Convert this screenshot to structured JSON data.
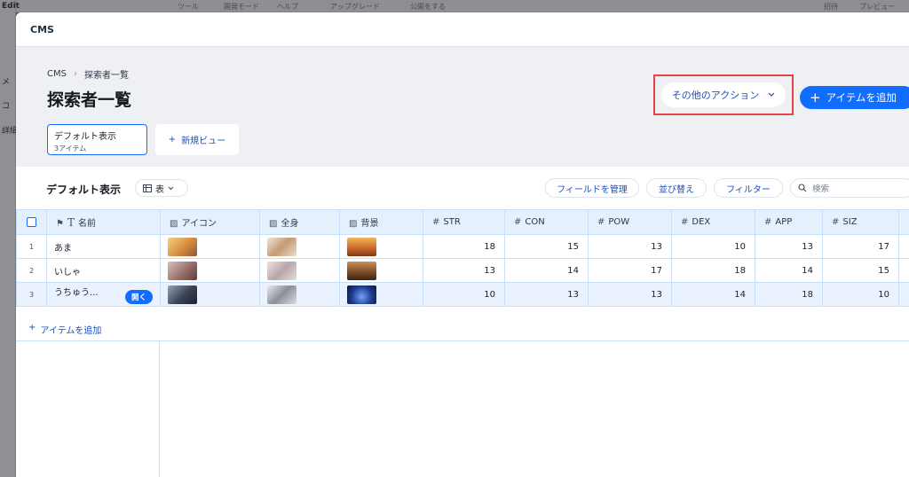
{
  "background": {
    "left_labels": [
      "Edit",
      "メ",
      "コ",
      "詳細"
    ],
    "top_labels": [
      "ツール",
      "開発モード",
      "ヘルプ",
      "アップグレード",
      "公開をする",
      "招待",
      "プレビュー"
    ]
  },
  "modal": {
    "title": "CMS"
  },
  "breadcrumb": {
    "root": "CMS",
    "current": "探索者一覧"
  },
  "page_title": "探索者一覧",
  "actions": {
    "more": "その他のアクション",
    "add_item": "アイテムを追加"
  },
  "views": {
    "default_name": "デフォルト表示",
    "default_count": "3アイテム",
    "new_view": "新規ビュー"
  },
  "toolbar": {
    "title": "デフォルト表示",
    "layout": "表",
    "manage_fields": "フィールドを管理",
    "sort": "並び替え",
    "filter": "フィルター",
    "search_placeholder": "検索"
  },
  "table": {
    "columns": [
      {
        "label": "名前",
        "icon": "text-icon"
      },
      {
        "label": "アイコン",
        "icon": "image-icon"
      },
      {
        "label": "全身",
        "icon": "image-icon"
      },
      {
        "label": "背景",
        "icon": "image-icon"
      },
      {
        "label": "STR",
        "icon": "number-icon"
      },
      {
        "label": "CON",
        "icon": "number-icon"
      },
      {
        "label": "POW",
        "icon": "number-icon"
      },
      {
        "label": "DEX",
        "icon": "number-icon"
      },
      {
        "label": "APP",
        "icon": "number-icon"
      },
      {
        "label": "SIZ",
        "icon": "number-icon"
      }
    ],
    "rows": [
      {
        "no": "1",
        "name": "あま",
        "str": "18",
        "con": "15",
        "pow": "13",
        "dex": "10",
        "app": "13",
        "siz": "17",
        "colors": [
          "#e8b070",
          "#d9c3b0",
          "#c86a2a"
        ]
      },
      {
        "no": "2",
        "name": "いしゃ",
        "str": "13",
        "con": "14",
        "pow": "17",
        "dex": "18",
        "app": "14",
        "siz": "15",
        "colors": [
          "#a8878a",
          "#cfc2c6",
          "#7a4a25"
        ]
      },
      {
        "no": "3",
        "name": "うちゅう...",
        "str": "10",
        "con": "13",
        "pow": "13",
        "dex": "14",
        "app": "18",
        "siz": "10",
        "colors": [
          "#4f5a70",
          "#b5b8bf",
          "#1e3c8c"
        ]
      }
    ],
    "open_label": "開く",
    "add_item": "アイテムを追加"
  },
  "colors": {
    "accent": "#116dff",
    "highlight_border": "#e0454a"
  }
}
